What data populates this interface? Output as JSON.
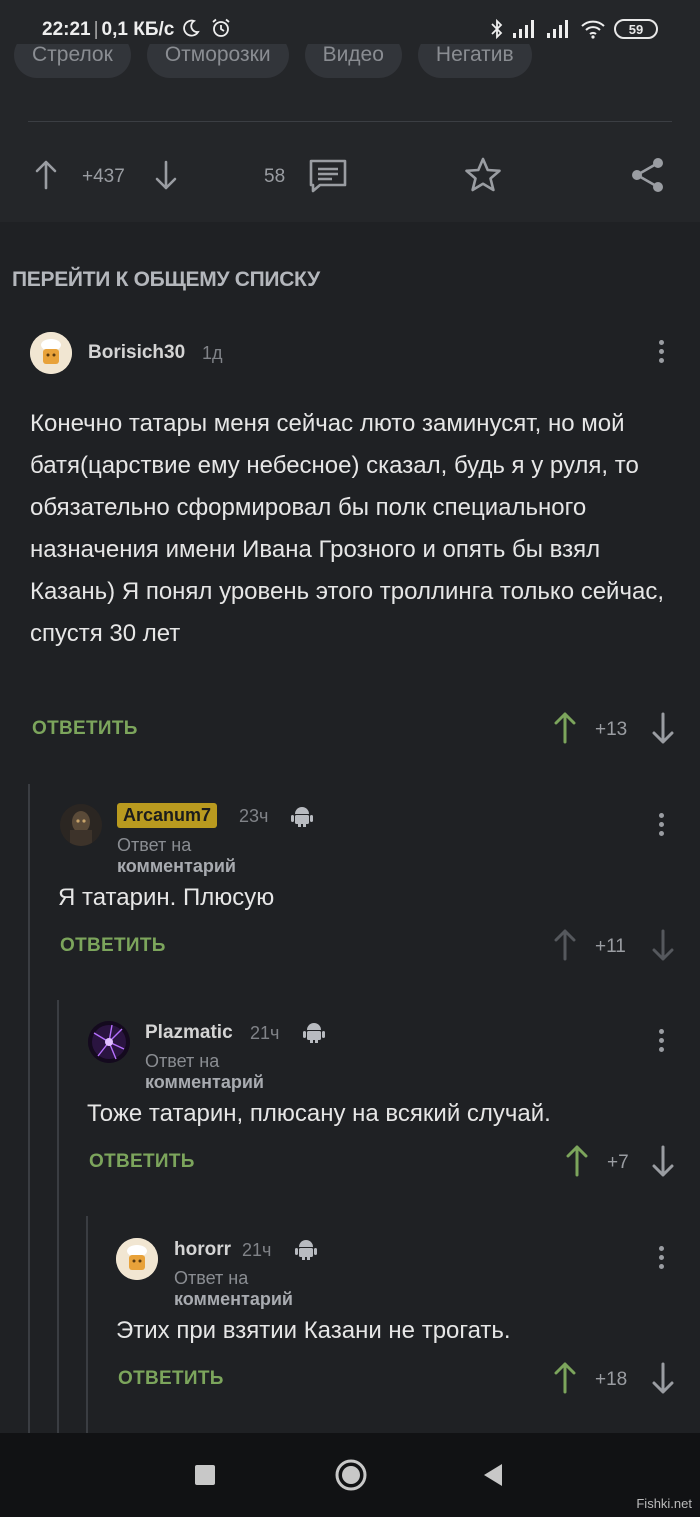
{
  "status_bar": {
    "time": "22:21",
    "speed": "0,1 КБ/с",
    "battery": "59"
  },
  "post": {
    "tags": [
      "Стрелок",
      "Отморозки",
      "Видео",
      "Негатив"
    ],
    "rating": "+437",
    "comments_count": "58"
  },
  "goto_label": "ПЕРЕЙТИ К ОБЩЕМУ СПИСКУ",
  "comments": [
    {
      "username": "Borisich30",
      "time": "1д",
      "text": "Конечно татары меня сейчас люто заминусят, но мой батя(царствие ему небесное) сказал, будь я у руля, то обязательно сформировал бы полк специального назначения имени Ивана Грозного и опять бы взял Казань) Я понял уровень этого троллинга только сейчас, спустя 30 лет",
      "reply_label": "ОТВЕТИТЬ",
      "score": "+13"
    },
    {
      "username": "Arcanum7",
      "time": "23ч",
      "reply_prefix": "Ответ на",
      "reply_target": "комментарий",
      "text": "Я татарин. Плюсую",
      "reply_label": "ОТВЕТИТЬ",
      "score": "+11"
    },
    {
      "username": "Plazmatic",
      "time": "21ч",
      "reply_prefix": "Ответ на",
      "reply_target": "комментарий",
      "text": "Тоже татарин, плюсану на всякий случай.",
      "reply_label": "ОТВЕТИТЬ",
      "score": "+7"
    },
    {
      "username": "hororr",
      "time": "21ч",
      "reply_prefix": "Ответ на",
      "reply_target": "комментарий",
      "text": "Этих при взятии Казани не трогать.",
      "reply_label": "ОТВЕТИТЬ",
      "score": "+18"
    }
  ],
  "watermark": "Fishki.net",
  "colors": {
    "background": "#1f2124",
    "accent_green": "#7ca55c",
    "badge_gold": "#b99a1f"
  }
}
